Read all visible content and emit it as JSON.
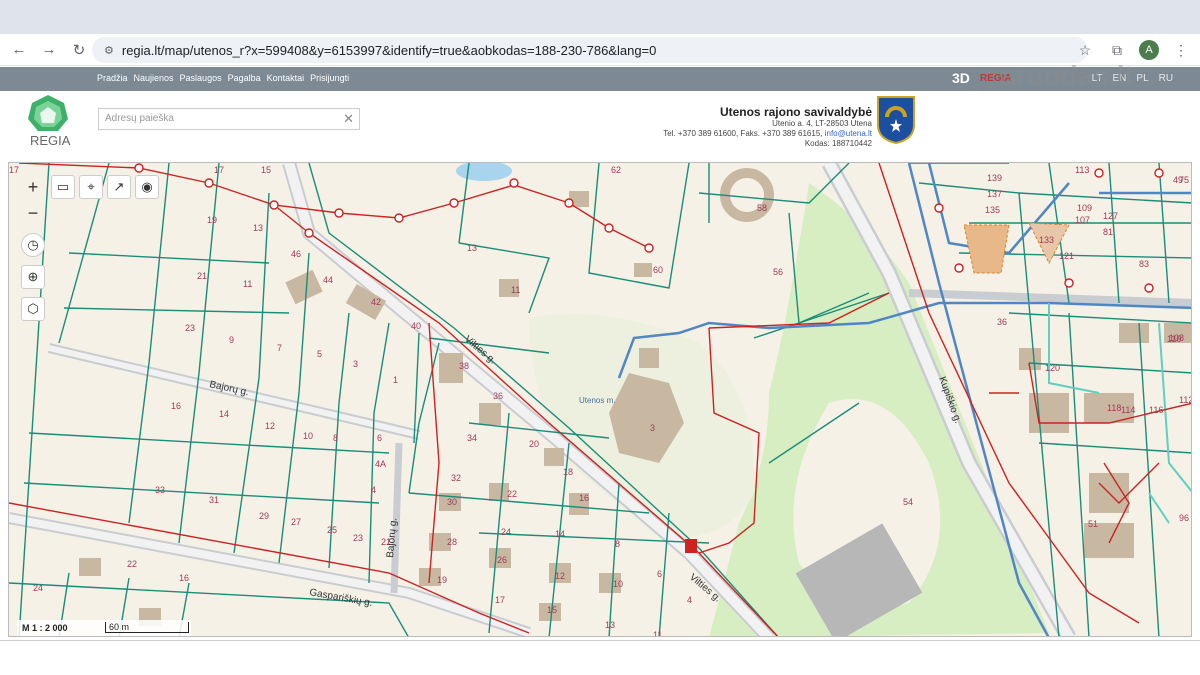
{
  "browser": {
    "url": "regia.lt/map/utenos_r?x=599408&y=6153997&identify=true&aobkodas=188-230-786&lang=0",
    "avatar_letter": "A"
  },
  "site": {
    "nav": [
      "Pradžia",
      "Naujienos",
      "Paslaugos",
      "Pagalba",
      "Kontaktai",
      "Prisijungti"
    ],
    "btn_3d": "3D",
    "regia_link": "REGIA",
    "langs": [
      "LT",
      "EN",
      "PL",
      "RU"
    ],
    "watermark": "aruodas.lt"
  },
  "header": {
    "logo_text": "REGIA",
    "search_placeholder": "Adresų paieška",
    "municipality_name": "Utenos rajono savivaldybė",
    "address": "Utenio a. 4, LT-28503 Utena",
    "phones": "Tel. +370 389 61600, Faks. +370 389 61615,",
    "email": "info@utena.lt",
    "code": "Kodas: 188710442"
  },
  "map": {
    "scale_label": "M 1 : 2 000",
    "scale_bar": "60 m",
    "streets": [
      "Bajorų g.",
      "Vilties g.",
      "Bajorų g.",
      "Gaspariškių g.",
      "Vilties g.",
      "Kupiškio g."
    ],
    "place_label": "Utenos m.",
    "parcel_numbers": [
      "17",
      "15",
      "19",
      "13",
      "46",
      "21",
      "11",
      "44",
      "42",
      "40",
      "23",
      "9",
      "7",
      "5",
      "3",
      "1",
      "38",
      "36",
      "34",
      "16",
      "14",
      "12",
      "10",
      "8",
      "6",
      "4A",
      "4",
      "33",
      "31",
      "29",
      "27",
      "25",
      "23",
      "21",
      "32",
      "30",
      "28",
      "22",
      "24",
      "20",
      "18",
      "16",
      "26",
      "19",
      "17",
      "14",
      "12",
      "15",
      "13",
      "11",
      "8",
      "10",
      "6",
      "4",
      "24",
      "22",
      "16",
      "62",
      "60",
      "58",
      "56",
      "13",
      "11",
      "3",
      "54",
      "36",
      "120",
      "118",
      "116",
      "114",
      "112",
      "110",
      "108",
      "51",
      "96",
      "113",
      "137",
      "135",
      "139",
      "107",
      "109",
      "133",
      "121",
      "127",
      "81",
      "83",
      "75",
      "49",
      "17"
    ]
  },
  "colors": {
    "site_bar": "#7d8a94",
    "parcel_line": "#1a8c7a",
    "power_line": "#cc2222",
    "water_line": "#4f86c6",
    "forest": "#d7edc2"
  }
}
